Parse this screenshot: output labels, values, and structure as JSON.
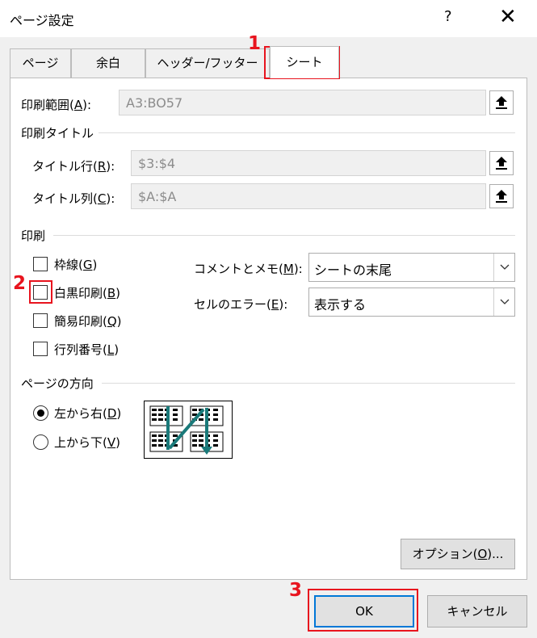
{
  "window": {
    "title": "ページ設定",
    "help": "?",
    "close": "✕"
  },
  "tabs": [
    {
      "label": "ページ"
    },
    {
      "label": "余白"
    },
    {
      "label": "ヘッダー/フッター"
    },
    {
      "label": "シート"
    }
  ],
  "print_area": {
    "label_pre": "印刷範囲(",
    "key": "A",
    "label_post": "):",
    "value": "A3:BO57"
  },
  "print_titles": {
    "heading": "印刷タイトル",
    "rows": {
      "label_pre": "タイトル行(",
      "key": "R",
      "label_post": "):",
      "value": "$3:$4"
    },
    "cols": {
      "label_pre": "タイトル列(",
      "key": "C",
      "label_post": "):",
      "value": "$A:$A"
    }
  },
  "print": {
    "heading": "印刷",
    "gridlines": {
      "label_pre": "枠線(",
      "key": "G",
      "label_post": ")",
      "checked": false
    },
    "bw": {
      "label_pre": "白黒印刷(",
      "key": "B",
      "label_post": ")",
      "checked": false
    },
    "draft": {
      "label_pre": "簡易印刷(",
      "key": "Q",
      "label_post": ")",
      "checked": false
    },
    "headings": {
      "label_pre": "行列番号(",
      "key": "L",
      "label_post": ")",
      "checked": false
    },
    "comments": {
      "label_pre": "コメントとメモ(",
      "key": "M",
      "label_post": "):",
      "value": "シートの末尾"
    },
    "errors": {
      "label_pre": "セルのエラー(",
      "key": "E",
      "label_post": "):",
      "value": "表示する"
    }
  },
  "page_order": {
    "heading": "ページの方向",
    "down_then_over": {
      "label_pre": "左から右(",
      "key": "D",
      "label_post": ")",
      "selected": true
    },
    "over_then_down": {
      "label_pre": "上から下(",
      "key": "V",
      "label_post": ")",
      "selected": false
    }
  },
  "buttons": {
    "options_pre": "オプション(",
    "options_key": "O",
    "options_post": ")...",
    "ok": "OK",
    "cancel": "キャンセル"
  },
  "annotations": {
    "n1": "1",
    "n2": "2",
    "n3": "3"
  },
  "colors": {
    "annotation": "#e8141e",
    "accent": "#0078d7",
    "diagram_arrow": "#1a7a7a"
  }
}
